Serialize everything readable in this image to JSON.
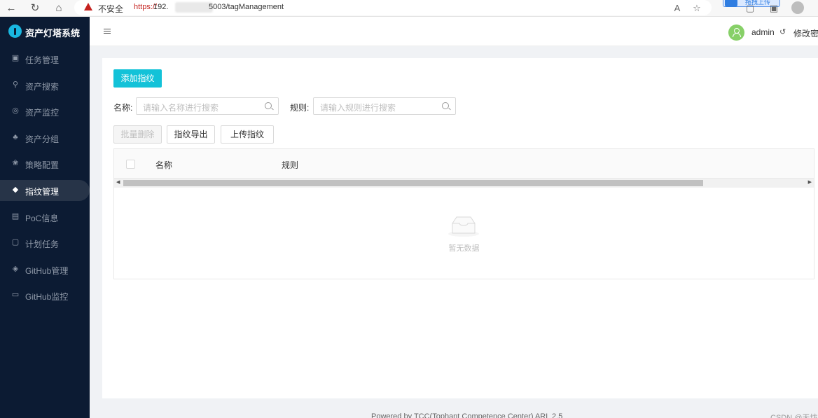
{
  "browser": {
    "security_warning": "不安全",
    "url_scheme": "https://",
    "url_host_visible": "192.",
    "url_path": "5003/tagManagement",
    "upload_label": "拖拽上传"
  },
  "app": {
    "title": "资产灯塔系统"
  },
  "sidebar": {
    "items": [
      {
        "label": "任务管理",
        "icon": "task-icon",
        "glyph": "▣"
      },
      {
        "label": "资产搜索",
        "icon": "search-icon",
        "glyph": "⚲"
      },
      {
        "label": "资产监控",
        "icon": "shield-icon",
        "glyph": "◎"
      },
      {
        "label": "资产分组",
        "icon": "cluster-icon",
        "glyph": "♣"
      },
      {
        "label": "策略配置",
        "icon": "config-icon",
        "glyph": "❀"
      },
      {
        "label": "指纹管理",
        "icon": "tag-icon",
        "glyph": "◆"
      },
      {
        "label": "PoC信息",
        "icon": "document-icon",
        "glyph": "▤"
      },
      {
        "label": "计划任务",
        "icon": "schedule-icon",
        "glyph": "▢"
      },
      {
        "label": "GitHub管理",
        "icon": "github-icon",
        "glyph": "◈"
      },
      {
        "label": "GitHub监控",
        "icon": "monitor-icon",
        "glyph": "▭"
      }
    ],
    "active_index": 5
  },
  "header": {
    "user_name": "admin",
    "change_password": "修改密码"
  },
  "toolbar": {
    "add_fingerprint": "添加指纹",
    "name_label": "名称:",
    "name_placeholder": "请输入名称进行搜索",
    "rule_label": "规则:",
    "rule_placeholder": "请输入规则进行搜索",
    "batch_delete": "批量删除",
    "export": "指纹导出",
    "upload": "上传指纹"
  },
  "table": {
    "columns": [
      "名称",
      "规则"
    ],
    "empty_text": "暂无数据"
  },
  "footer": {
    "text": "Powered by TCC(Tophant Competence Center) ARL 2.5",
    "watermark": "CSDN @天坊"
  },
  "colors": {
    "sidebar_bg": "#0c1b33",
    "primary": "#13c2d8",
    "avatar": "#87d068"
  }
}
